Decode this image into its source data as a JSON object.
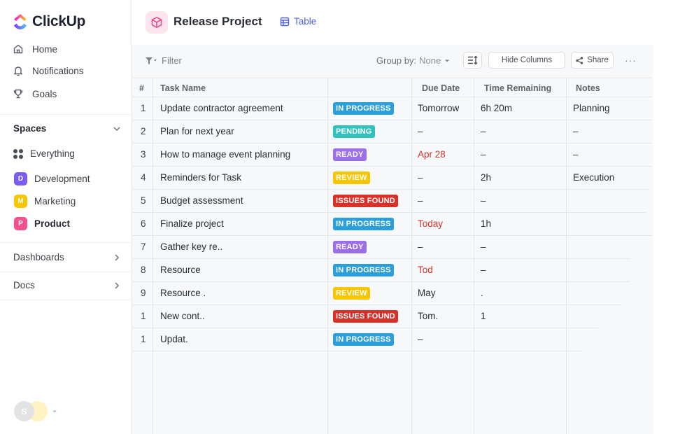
{
  "app": {
    "name": "ClickUp"
  },
  "colors": {
    "in_progress": "#2a9fdc",
    "pending": "#30c3bd",
    "ready": "#9b6fe8",
    "review": "#f7c600",
    "issues_found": "#d6322a",
    "overdue_text": "#d0342c",
    "accent": "#4d62e0"
  },
  "sidebar": {
    "nav": [
      {
        "label": "Home",
        "icon": "home-icon"
      },
      {
        "label": "Notifications",
        "icon": "bell-icon"
      },
      {
        "label": "Goals",
        "icon": "trophy-icon"
      }
    ],
    "spaces_label": "Spaces",
    "everything_label": "Everything",
    "spaces": [
      {
        "letter": "D",
        "label": "Development",
        "color": "#7b5cf0"
      },
      {
        "letter": "M",
        "label": "Marketing",
        "color": "#f7c600"
      },
      {
        "letter": "P",
        "label": "Product",
        "color": "#f2508f"
      }
    ],
    "dashboards_label": "Dashboards",
    "docs_label": "Docs",
    "avatar_letter": "S"
  },
  "header": {
    "title": "Release Project",
    "view_label": "Table"
  },
  "toolbar": {
    "filter_label": "Filter",
    "group_by_label": "Group by:",
    "group_by_value": "None",
    "hide_columns_label": "Hide Columns",
    "share_label": "Share",
    "more_label": "···"
  },
  "table": {
    "columns": {
      "num": "#",
      "task": "Task Name",
      "status": "",
      "due": "Due Date",
      "remaining": "Time Remaining",
      "notes": "Notes"
    },
    "rows": [
      {
        "num": "1",
        "task": "Update contractor agreement",
        "status": "IN PROGRESS",
        "status_key": "in_progress",
        "due": "Tomorrow",
        "due_overdue": false,
        "remaining": "6h 20m",
        "notes": "Planning"
      },
      {
        "num": "2",
        "task": "Plan for next year",
        "status": "PENDING",
        "status_key": "pending",
        "due": "–",
        "due_overdue": false,
        "remaining": "–",
        "notes": "–"
      },
      {
        "num": "3",
        "task": "How to manage event planning",
        "status": "READY",
        "status_key": "ready",
        "due": "Apr 28",
        "due_overdue": true,
        "remaining": "–",
        "notes": "–"
      },
      {
        "num": "4",
        "task": "Reminders for Task",
        "status": "REVIEW",
        "status_key": "review",
        "due": "–",
        "due_overdue": false,
        "remaining": "2h",
        "notes": "Execution"
      },
      {
        "num": "5",
        "task": "Budget assessment",
        "status": "ISSUES FOUND",
        "status_key": "issues_found",
        "due": "–",
        "due_overdue": false,
        "remaining": "–",
        "notes": ""
      },
      {
        "num": "6",
        "task": "Finalize project",
        "status": "IN PROGRESS",
        "status_key": "in_progress",
        "due": "Today",
        "due_overdue": true,
        "remaining": "1h",
        "notes": ""
      },
      {
        "num": "7",
        "task": "Gather key re..",
        "status": "READY",
        "status_key": "ready",
        "due": "–",
        "due_overdue": false,
        "remaining": "–",
        "notes": ""
      },
      {
        "num": "8",
        "task": "Resource",
        "status": "IN PROGRESS",
        "status_key": "in_progress",
        "due": "Tod",
        "due_overdue": true,
        "remaining": "–",
        "notes": ""
      },
      {
        "num": "9",
        "task": "Resource .",
        "status": "REVIEW",
        "status_key": "review",
        "due": "May",
        "due_overdue": false,
        "remaining": ".",
        "notes": ""
      },
      {
        "num": "1",
        "task": "New cont..",
        "status": "ISSUES FOUND",
        "status_key": "issues_found",
        "due": "Tom.",
        "due_overdue": false,
        "remaining": "1",
        "notes": ""
      },
      {
        "num": "1",
        "task": "Updat.",
        "status": "IN PROGRESS",
        "status_key": "in_progress",
        "due": "–",
        "due_overdue": false,
        "remaining": "",
        "notes": ""
      }
    ]
  }
}
